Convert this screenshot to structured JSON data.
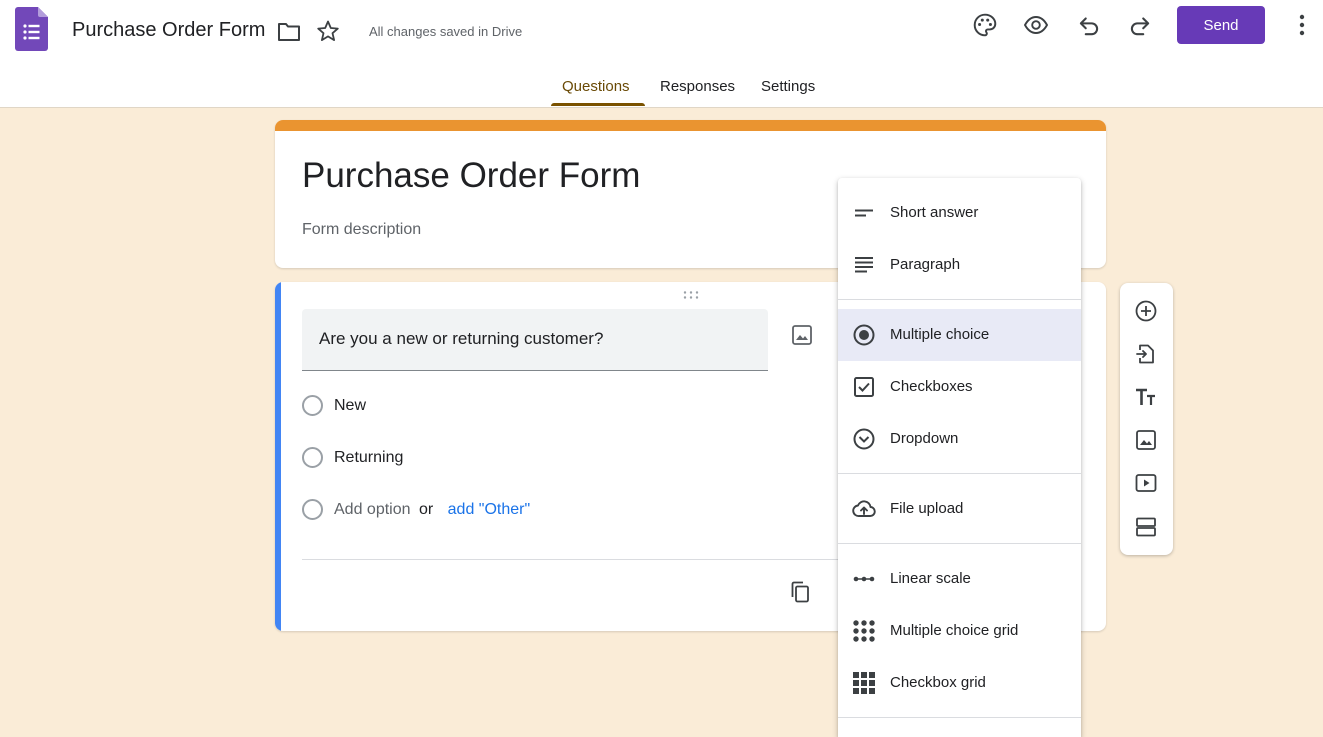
{
  "header": {
    "doc_title": "Purchase Order Form",
    "save_status": "All changes saved in Drive",
    "send_label": "Send",
    "icons": [
      "forms-logo-icon",
      "folder-icon",
      "star-icon",
      "palette-icon",
      "preview-eye-icon",
      "undo-icon",
      "redo-icon",
      "more-vert-icon"
    ],
    "accent_color": "#673ab7"
  },
  "tabs": [
    {
      "label": "Questions",
      "active": true
    },
    {
      "label": "Responses",
      "active": false
    },
    {
      "label": "Settings",
      "active": false
    }
  ],
  "form": {
    "title": "Purchase Order Form",
    "description_placeholder": "Form description",
    "theme_color": "#ea9430",
    "background_color": "#faecd7"
  },
  "question": {
    "text": "Are you a new or returning customer?",
    "options": [
      "New",
      "Returning"
    ],
    "add_option": "Add option",
    "or": "or",
    "add_other": "add \"Other\""
  },
  "question_type_menu": {
    "selected": "Multiple choice",
    "items": [
      {
        "label": "Short answer",
        "icon": "short-answer-icon"
      },
      {
        "label": "Paragraph",
        "icon": "paragraph-icon"
      },
      {
        "label": "Multiple choice",
        "icon": "radio-button-icon"
      },
      {
        "label": "Checkboxes",
        "icon": "checkbox-icon"
      },
      {
        "label": "Dropdown",
        "icon": "dropdown-circle-icon"
      },
      {
        "label": "File upload",
        "icon": "cloud-upload-icon"
      },
      {
        "label": "Linear scale",
        "icon": "linear-scale-icon"
      },
      {
        "label": "Multiple choice grid",
        "icon": "dot-grid-icon"
      },
      {
        "label": "Checkbox grid",
        "icon": "square-grid-icon"
      }
    ]
  },
  "side_toolbar": {
    "icons": [
      "add-question-icon",
      "import-questions-icon",
      "add-title-icon",
      "add-image-icon",
      "add-video-icon",
      "add-section-icon"
    ]
  }
}
